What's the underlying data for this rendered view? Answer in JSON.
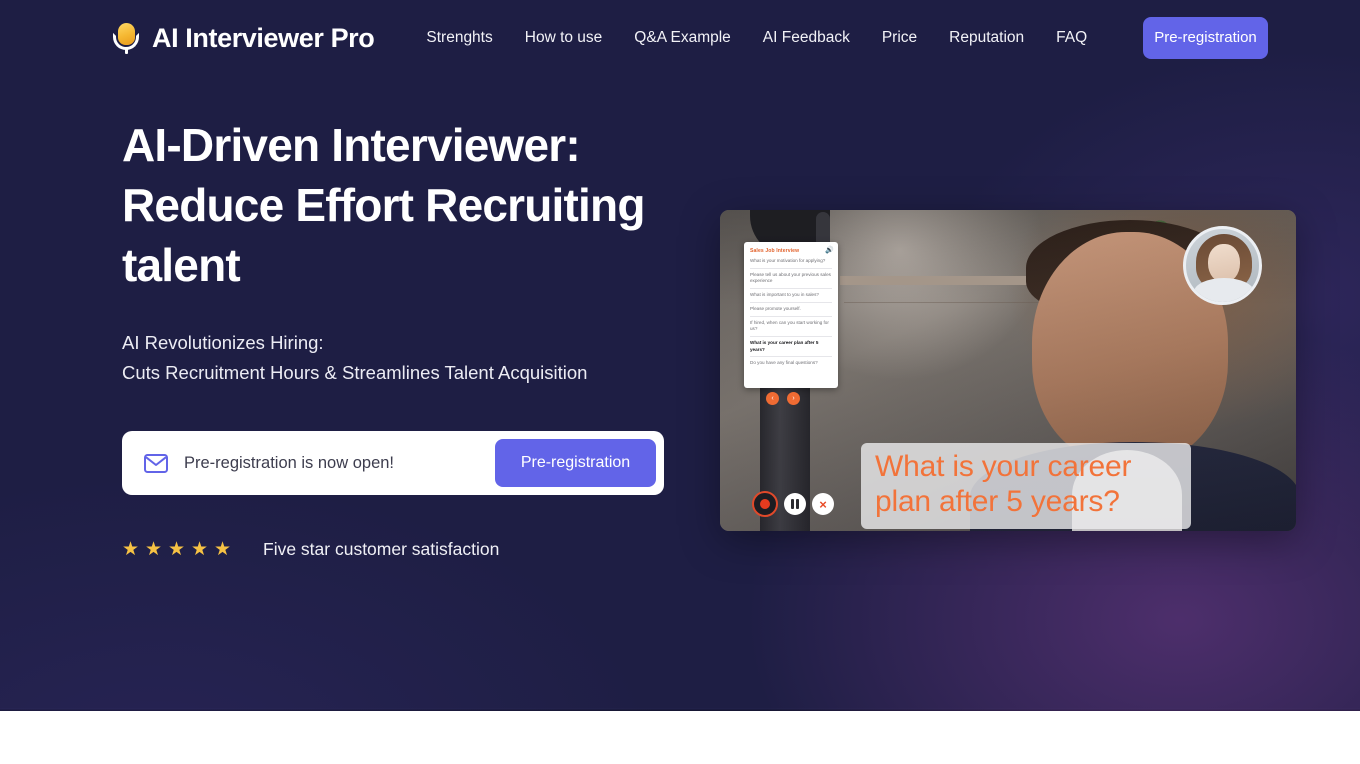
{
  "brand": {
    "name": "AI Interviewer Pro",
    "logo_icon": "microphone-icon"
  },
  "nav": {
    "links": [
      {
        "label": "Strenghts"
      },
      {
        "label": "How to use"
      },
      {
        "label": "Q&A Example"
      },
      {
        "label": "AI Feedback"
      },
      {
        "label": "Price"
      },
      {
        "label": "Reputation"
      },
      {
        "label": "FAQ"
      }
    ],
    "cta_label": "Pre-registration"
  },
  "hero": {
    "headline": "AI-Driven Interviewer: Reduce Effort Recruiting talent",
    "subhead_line1": "AI Revolutionizes Hiring:",
    "subhead_line2": "Cuts Recruitment Hours & Streamlines Talent Acquisition",
    "signup": {
      "mail_icon": "envelope-icon",
      "message": "Pre-registration is now open!",
      "button_label": "Pre-registration"
    },
    "rating": {
      "star_glyph": "★",
      "star_count": 5,
      "text": "Five star customer satisfaction"
    }
  },
  "media": {
    "question_panel": {
      "title": "Sales Job Interview",
      "speaker_icon": "speaker-icon",
      "questions": [
        {
          "text": "What is your motivation for applying?",
          "active": false
        },
        {
          "text": "Please tell us about your previous sales experience",
          "active": false
        },
        {
          "text": "What is important to you in sales?",
          "active": false
        },
        {
          "text": "Please promote yourself.",
          "active": false
        },
        {
          "text": "If hired, when can you start working for us?",
          "active": false
        },
        {
          "text": "What is your career plan after 5 years?",
          "active": true
        },
        {
          "text": "Do you have any final questions?",
          "active": false
        }
      ],
      "prev_label": "‹",
      "next_label": "›"
    },
    "caption": "What is your career plan after 5 years?",
    "controls": [
      {
        "name": "record",
        "label": ""
      },
      {
        "name": "pause",
        "label": ""
      },
      {
        "name": "close",
        "label": "×"
      }
    ],
    "avatar_alt": "interviewer-avatar"
  },
  "colors": {
    "hero_background": "#1e1e44",
    "accent_purple": "#6264e8",
    "star_gold": "#f6c244",
    "caption_orange": "#f2733a",
    "panel_title_orange": "#e2622c"
  }
}
